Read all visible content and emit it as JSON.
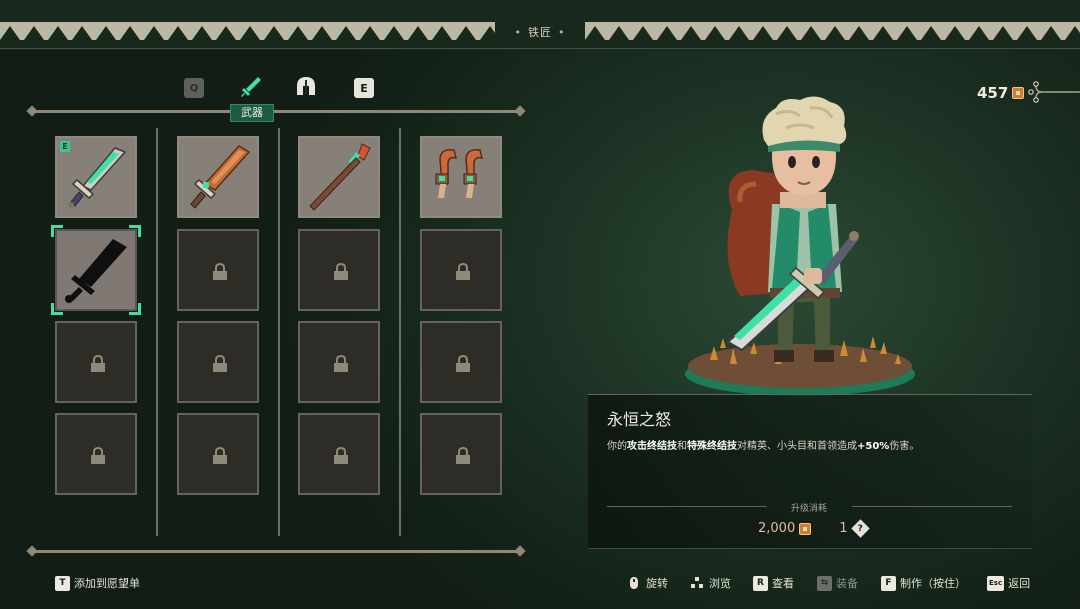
{
  "header": {
    "title": "铁匠"
  },
  "tabs": {
    "prev_key": "Q",
    "next_key": "E",
    "active_label": "武器",
    "items": [
      {
        "name": "weapon-tab",
        "icon": "sword-icon",
        "active": true
      },
      {
        "name": "armor-tab",
        "icon": "helmet-icon",
        "active": false
      }
    ]
  },
  "grid": {
    "columns": [
      {
        "slots": [
          "equipped-sword",
          "selected-greatsword-silhouette",
          "locked",
          "locked"
        ]
      },
      {
        "slots": [
          "orange-greatsword",
          "locked",
          "locked",
          "locked"
        ]
      },
      {
        "slots": [
          "spear",
          "locked",
          "locked",
          "locked"
        ]
      },
      {
        "slots": [
          "twin-daggers",
          "locked",
          "locked",
          "locked"
        ]
      }
    ],
    "equipped_badge": "E"
  },
  "currency": {
    "amount": "457",
    "icon": "gold-coin-icon"
  },
  "item": {
    "title": "永恒之怒",
    "desc_parts": [
      "你的",
      "攻击终结技",
      "和",
      "特殊终结技",
      "对精英、小头目和首领造成",
      "+50%",
      "伤害。"
    ],
    "cost_label": "升级消耗",
    "cost_gold": "2,000",
    "cost_qty": "1",
    "qty_icon_text": "?"
  },
  "footer": {
    "wishlist": {
      "key": "T",
      "label": "添加到愿望单"
    },
    "rotate": {
      "label": "旋转"
    },
    "browse": {
      "label": "浏览"
    },
    "view": {
      "key": "R",
      "label": "查看"
    },
    "equip": {
      "label": "装备"
    },
    "craft": {
      "key": "F",
      "label": "制作（按住）"
    },
    "back": {
      "key": "Esc",
      "label": "返回"
    }
  },
  "colors": {
    "accent": "#3ee0a6",
    "panel_bg": "#142419",
    "gold": "#d07c34"
  }
}
